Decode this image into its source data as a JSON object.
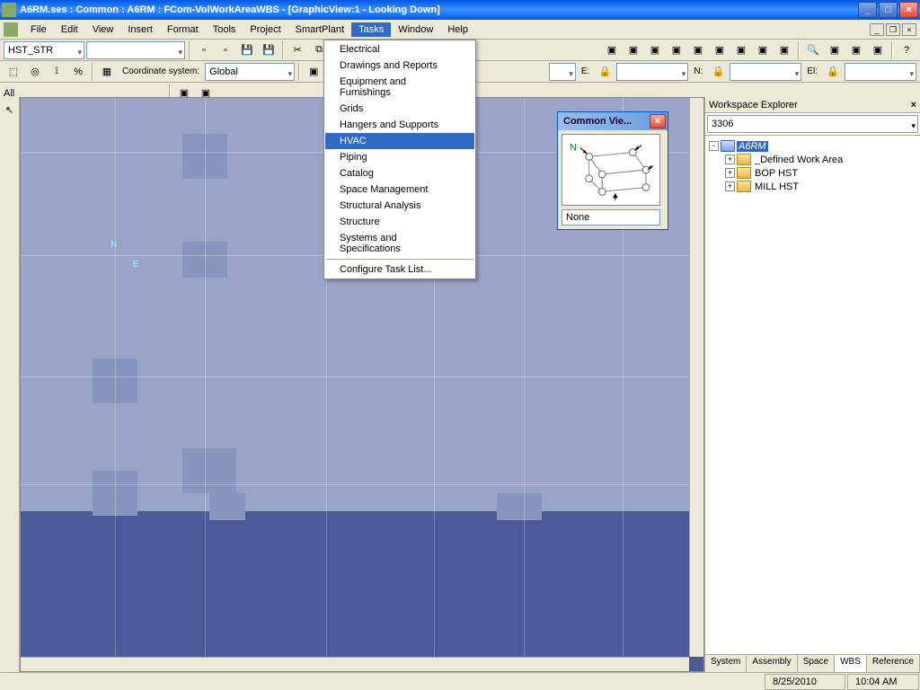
{
  "window": {
    "title": "A6RM.ses : Common : A6RM : FCom-VolWorkAreaWBS - [GraphicView:1 - Looking Down]"
  },
  "menubar": {
    "items": [
      "File",
      "Edit",
      "View",
      "Insert",
      "Format",
      "Tools",
      "Project",
      "SmartPlant",
      "Tasks",
      "Window",
      "Help"
    ],
    "active_index": 8
  },
  "tasks_menu": {
    "items": [
      "Electrical",
      "Drawings and Reports",
      "Equipment and Furnishings",
      "Grids",
      "Hangers and Supports",
      "HVAC",
      "Piping",
      "Catalog",
      "Space Management",
      "Structural Analysis",
      "Structure",
      "Systems and Specifications"
    ],
    "hover_index": 5,
    "footer": "Configure Task List..."
  },
  "toolbar1": {
    "combo1": "HST_STR",
    "combo2": "",
    "coord_label": "Coordinate system:",
    "coord_value": "Global",
    "e_label": "E:",
    "n_label": "N:",
    "el_label": "El:"
  },
  "toolbar3": {
    "filter": "All"
  },
  "common_view": {
    "title": "Common Vie...",
    "value": "None",
    "compass": "N"
  },
  "explorer": {
    "title": "Workspace Explorer",
    "combo": "3306",
    "root": "A6RM",
    "children": [
      "_Defined Work Area",
      "BOP HST",
      "MILL HST"
    ],
    "tabs": [
      "System",
      "Assembly",
      "Space",
      "WBS",
      "Reference"
    ],
    "active_tab": 3
  },
  "statusbar": {
    "date": "8/25/2010",
    "time": "10:04 AM"
  },
  "viewport_marks": {
    "n": "N",
    "e": "E"
  }
}
